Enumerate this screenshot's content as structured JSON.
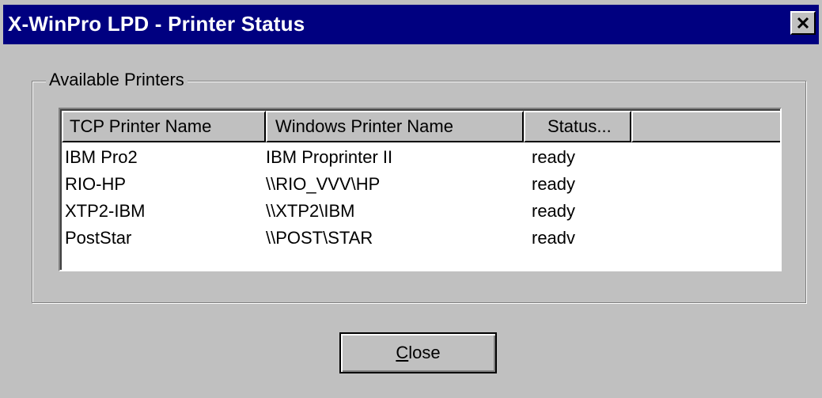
{
  "window": {
    "title": "X-WinPro LPD - Printer Status"
  },
  "group": {
    "label": "Available Printers"
  },
  "table": {
    "columns": [
      "TCP Printer Name",
      "Windows Printer Name",
      "Status..."
    ],
    "rows": [
      [
        "IBM Pro2",
        "IBM Proprinter II",
        "ready"
      ],
      [
        "RIO-HP",
        "\\\\RIO_VVV\\HP",
        "ready"
      ],
      [
        "XTP2-IBM",
        "\\\\XTP2\\IBM",
        "ready"
      ],
      [
        "PostStar",
        "\\\\POST\\STAR",
        "readv"
      ]
    ]
  },
  "buttons": {
    "close_mnemonic": "C",
    "close_rest": "lose"
  },
  "icons": {
    "close": "close-icon"
  },
  "colors": {
    "titlebar": "#000080",
    "face": "#c0c0c0"
  }
}
